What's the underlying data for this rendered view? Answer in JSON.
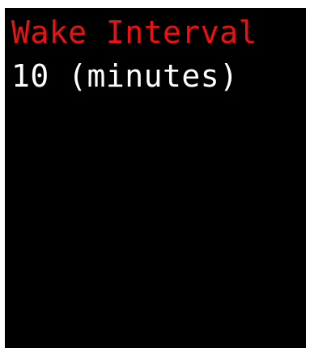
{
  "setting": {
    "title": "Wake Interval",
    "value": "10 (minutes)"
  },
  "colors": {
    "background": "#000000",
    "title": "#ee1111",
    "value": "#ffffff"
  }
}
